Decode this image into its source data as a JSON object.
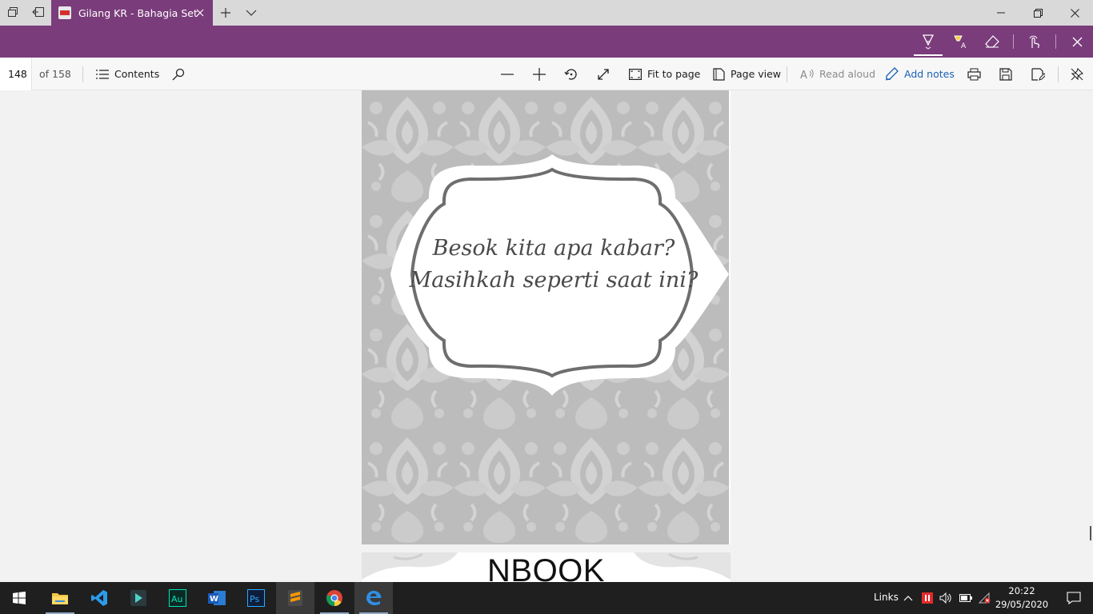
{
  "tab": {
    "title": "Gilang KR - Bahagia Set",
    "icon": "pdf-file-icon"
  },
  "toolbar": {
    "page_current": "148",
    "page_total": "of 158",
    "contents_label": "Contents",
    "fit_to_page_label": "Fit to page",
    "page_view_label": "Page view",
    "read_aloud_label": "Read aloud",
    "add_notes_label": "Add notes"
  },
  "document": {
    "quote_line1": "Besok kita apa kabar?",
    "quote_line2": "Masihkah seperti saat ini?",
    "next_page_title": "NBOOK"
  },
  "taskbar": {
    "apps": [
      "start-icon",
      "file-explorer-icon",
      "vscode-icon",
      "filmora-icon",
      "audition-icon",
      "word-icon",
      "photoshop-icon",
      "sublime-icon",
      "chrome-icon",
      "edge-icon"
    ],
    "links_label": "Links",
    "time": "20:22",
    "date": "29/05/2020"
  },
  "colors": {
    "accent_purple": "#7a3c7b",
    "taskbar": "#1f1f1f",
    "ornament_gray": "#bdbdbd",
    "frame_gray": "#6e6e6e"
  }
}
